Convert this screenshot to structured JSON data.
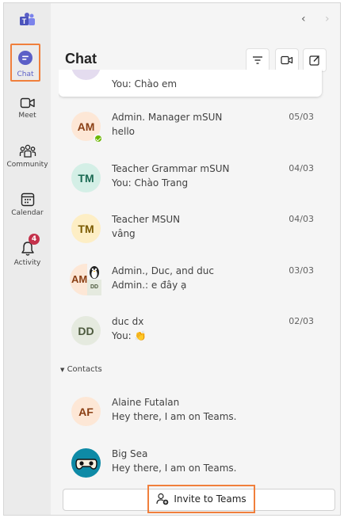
{
  "rail": {
    "items": [
      {
        "label": "Chat"
      },
      {
        "label": "Meet"
      },
      {
        "label": "Community"
      },
      {
        "label": "Calendar"
      },
      {
        "label": "Activity",
        "badge": "4"
      }
    ],
    "accent": "#5b5fc7",
    "highlight": "#f07f3c"
  },
  "header": {
    "title": "Chat"
  },
  "chats": [
    {
      "preview": "You: Chào em",
      "initials": "",
      "date": ""
    },
    {
      "name": "Admin. Manager mSUN",
      "preview": "hello",
      "initials": "AM",
      "date": "05/03"
    },
    {
      "name": "Teacher Grammar mSUN",
      "preview": "You: Chào Trang",
      "initials": "TM",
      "date": "04/03"
    },
    {
      "name": "Teacher MSUN",
      "preview": "vâng",
      "initials": "TM",
      "date": "04/03"
    },
    {
      "name": "Admin., Duc, and duc",
      "preview": "Admin.: e đây ạ",
      "initials": "AM",
      "sub_initials": "DD",
      "date": "03/03"
    },
    {
      "name": "duc dx",
      "preview": "You: 👏",
      "initials": "DD",
      "date": "02/03"
    }
  ],
  "contacts_section": "Contacts",
  "contacts": [
    {
      "name": "Alaine Futalan",
      "preview": "Hey there, I am on Teams.",
      "initials": "AF"
    },
    {
      "name": "Big Sea",
      "preview": "Hey there, I am on Teams."
    }
  ],
  "invite": {
    "label": "Invite to Teams"
  }
}
